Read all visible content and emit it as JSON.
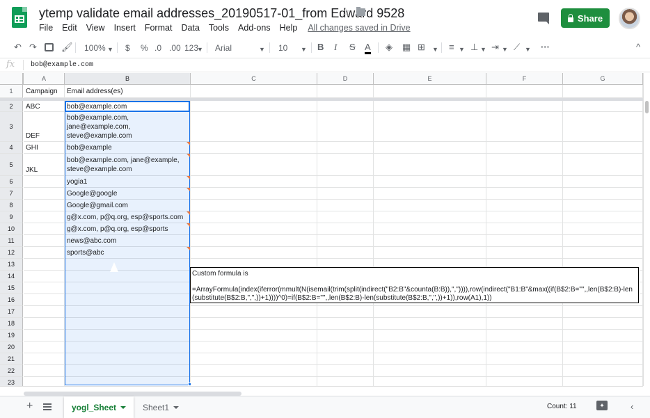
{
  "app": {
    "title": "ytemp validate email addresses_20190517-01_from Edward 9528",
    "star": "☆",
    "menu": [
      "File",
      "Edit",
      "View",
      "Insert",
      "Format",
      "Data",
      "Tools",
      "Add-ons",
      "Help"
    ],
    "saved_status": "All changes saved in Drive",
    "share_label": "Share",
    "brand_color": "#0f9d58",
    "share_color": "#1e8e3e"
  },
  "toolbar": {
    "zoom": "100%",
    "currency": "$",
    "percent": "%",
    "dec_decrease": ".0",
    "dec_increase": ".00",
    "more_formats": "123",
    "font": "Arial",
    "font_size": "10",
    "bold": "B",
    "italic": "I",
    "strike": "S",
    "text_color": "A",
    "more": "···",
    "collapse": "^"
  },
  "formula_bar": {
    "fx": "fx",
    "value": "bob@example.com"
  },
  "columns": [
    "A",
    "B",
    "C",
    "D",
    "E",
    "F",
    "G"
  ],
  "rows": [
    "1",
    "2",
    "3",
    "4",
    "5",
    "6",
    "7",
    "8",
    "9",
    "10",
    "11",
    "12",
    "13",
    "14",
    "15",
    "16",
    "17",
    "18",
    "19",
    "20",
    "21",
    "22",
    "23"
  ],
  "cells": {
    "A1": "Campaign",
    "B1": "Email address(es)",
    "A2": "ABC",
    "B2": "bob@example.com",
    "B3": "bob@example.com,\njane@example.com,\nsteve@example.com",
    "A3": "DEF",
    "A4": "GHI",
    "B4": "bob@example",
    "B5": "bob@example.com, jane@example,\nsteve@example.com",
    "A5": "JKL",
    "B6": "yogia1",
    "B7": "Google@google",
    "B8": "Google@gmail.com",
    "B9": "g@x.com, p@q.org, esp@sports.com",
    "B10": "g@x.com, p@q.org, esp@sports",
    "B11": "news@abc.com",
    "B12": "sports@abc"
  },
  "note": {
    "heading": "Custom formula is",
    "formula": "=ArrayFormula(index(iferror(mmult(N(isemail(trim(split(indirect(\"B2:B\"&counta(B:B)),\",\")))),row(indirect(\"B1:B\"&max((if(B$2:B=\"\",,len(B$2:B)-len(substitute(B$2:B,\",\",))+1))))^0)=if(B$2:B=\"\",,len(B$2:B)-len(substitute(B$2:B,\",\",))+1)),row(A1),1))"
  },
  "sheets": {
    "add": "+",
    "tabs": [
      {
        "label": "yogl_Sheet",
        "active": true
      },
      {
        "label": "Sheet1",
        "active": false
      }
    ]
  },
  "status": {
    "count": "Count: 11"
  },
  "selection_color": "#1a73e8",
  "invalid_marker_color": "#e67c4a"
}
